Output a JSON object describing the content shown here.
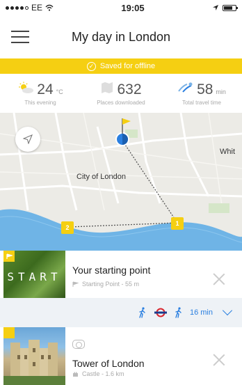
{
  "status_bar": {
    "carrier": "EE",
    "time": "19:05"
  },
  "header": {
    "title": "My day in London"
  },
  "offline_banner": {
    "text": "Saved for offline"
  },
  "stats": [
    {
      "value": "24",
      "unit": "°C",
      "label": "This evening",
      "icon": "weather-icon"
    },
    {
      "value": "632",
      "unit": "",
      "label": "Places downloaded",
      "icon": "map-download-icon"
    },
    {
      "value": "58",
      "unit": "min",
      "label": "Total travel time",
      "icon": "travel-icon"
    }
  ],
  "map": {
    "labels": {
      "city": "City of London",
      "whitechapel": "Whit"
    },
    "pins": [
      "1",
      "2"
    ]
  },
  "cards": [
    {
      "title": "Your starting point",
      "subtitle": "Starting Point - 55 m",
      "thumb_text": "START"
    },
    {
      "title": "Tower of London",
      "subtitle": "Castle - 1.6 km"
    }
  ],
  "route": {
    "time": "16 min"
  },
  "colors": {
    "accent": "#f5cf12",
    "route": "#2a7fe0"
  }
}
